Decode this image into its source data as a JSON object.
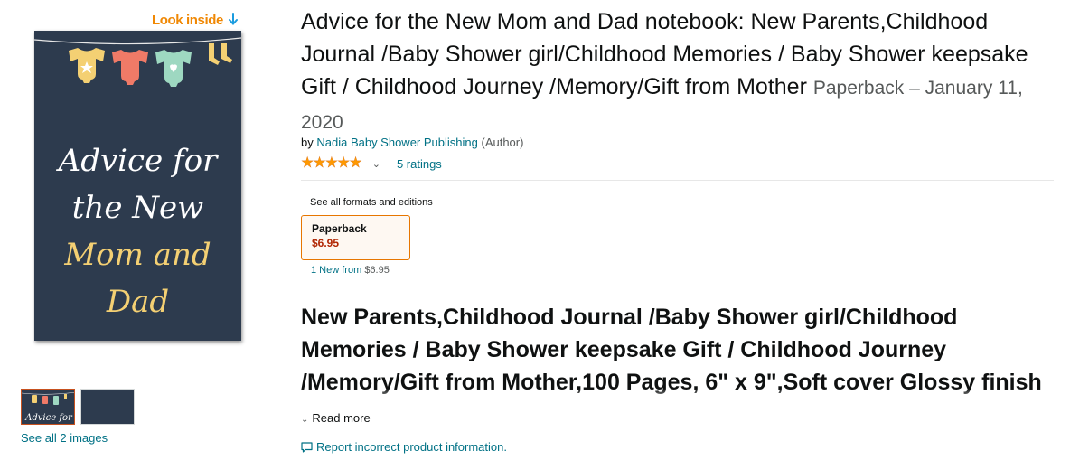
{
  "look_inside": {
    "label": "Look inside"
  },
  "cover": {
    "lines": [
      "Advice for",
      "the New",
      "Mom and",
      "Dad"
    ],
    "colors": {
      "background": "#2d3b4e",
      "title_white": "#ffffff",
      "title_yellow": "#f4d073",
      "onesie_yellow": "#f4d073",
      "onesie_coral": "#f07a67",
      "onesie_mint": "#9ed8c1"
    }
  },
  "thumbnails": {
    "items": [
      {
        "label": "Advice for"
      },
      {
        "label": ""
      }
    ],
    "see_all": "See all 2 images"
  },
  "product": {
    "title": "Advice for the New Mom and Dad notebook: New Parents,Childhood Journal /Baby Shower girl/Childhood Memories / Baby Shower keepsake Gift / Childhood Journey /Memory/Gift from Mother",
    "binding_date": "Paperback – January 11, 2020",
    "byline_prefix": "by",
    "author": "Nadia Baby Shower Publishing",
    "author_role": "(Author)",
    "rating": {
      "stars": 5,
      "ratings_text": "5 ratings"
    },
    "formats": {
      "see_all_label": "See all formats and editions",
      "selected": {
        "name": "Paperback",
        "price": "$6.95"
      },
      "new_from_prefix": "1 New from",
      "new_from_price": "$6.95"
    },
    "description": "New Parents,Childhood Journal /Baby Shower girl/Childhood Memories / Baby Shower keepsake Gift / Childhood Journey /Memory/Gift from Mother,100 Pages, 6\" x 9\",Soft cover Glossy finish",
    "read_more": "Read more",
    "report": "Report incorrect product information."
  },
  "colors": {
    "link": "#007185",
    "price": "#b12704",
    "star": "#ff9900",
    "accent_orange": "#f08804",
    "format_border": "#e77600"
  }
}
